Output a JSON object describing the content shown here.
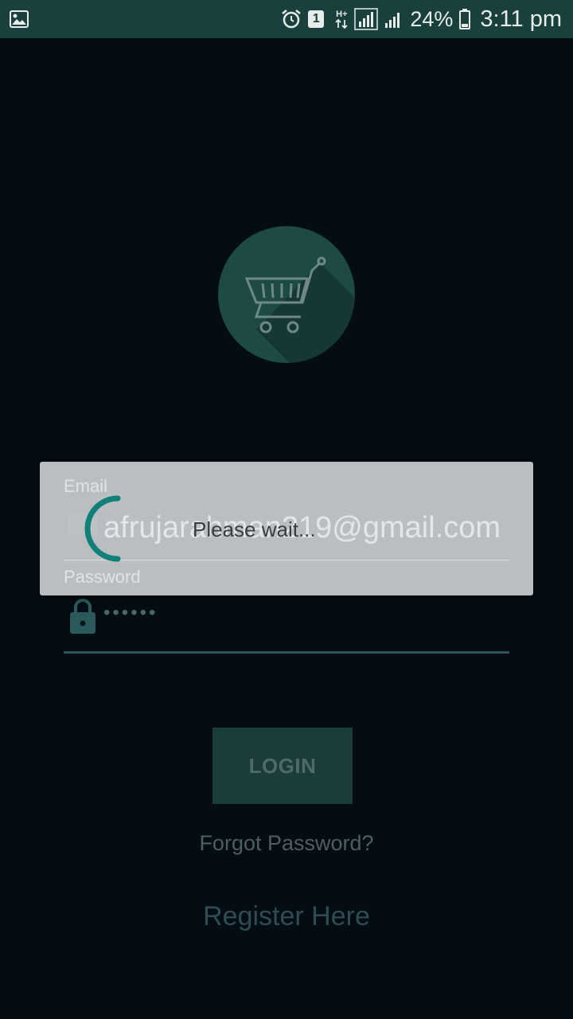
{
  "status_bar": {
    "sim_slot": "1",
    "network_type": "H+",
    "battery_percent": "24%",
    "time": "3:11 pm",
    "icons": [
      "gallery-icon",
      "alarm-icon",
      "sim-badge",
      "data-arrows-icon",
      "signal-icon",
      "battery-icon"
    ]
  },
  "login": {
    "email_label": "Email",
    "email_value": "afrujarahman219@gmail.com",
    "password_label": "Password",
    "password_value": "••••••",
    "login_button": "LOGIN",
    "forgot_link": "Forgot Password?",
    "register_link": "Register Here"
  },
  "dialog": {
    "message": "Please wait..."
  },
  "colors": {
    "background": "#040c14",
    "status_bar": "#19403c",
    "accent": "#1b8a80",
    "dialog": "#c4c8ca"
  }
}
